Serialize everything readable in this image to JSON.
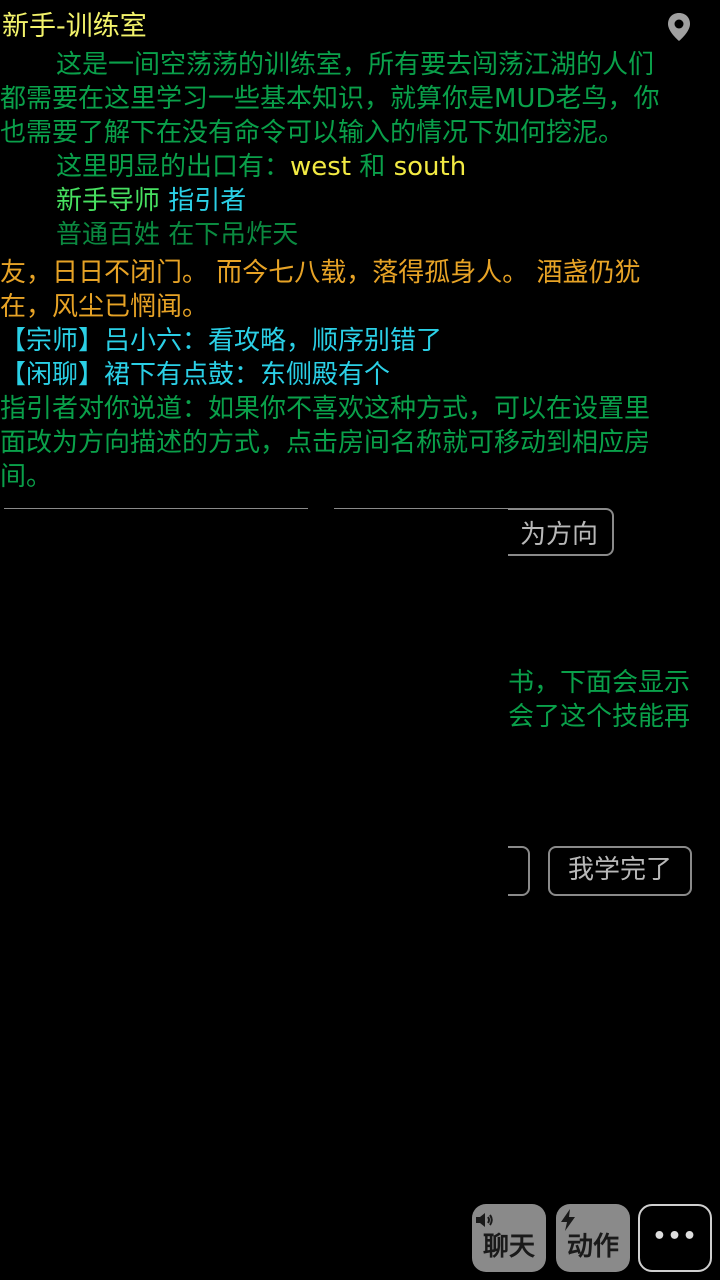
{
  "room": {
    "title": "新手-训练室",
    "location_icon": "map-pin-icon"
  },
  "description": {
    "line1": "这是一间空荡荡的训练室，所有要去闯荡江湖的人们",
    "line2": "都需要在这里学习一些基本知识，就算你是MUD老鸟，你",
    "line3": "也需要了解下在没有命令可以输入的情况下如何挖泥。"
  },
  "exits": {
    "prefix": "这里明显的出口有：",
    "dir1": "west",
    "conj": " 和 ",
    "dir2": "south"
  },
  "npcs": {
    "npc1_title": "新手导师",
    "npc1_name": " 指引者",
    "npc2": "普通百姓 在下吊炸天"
  },
  "poem": {
    "line1": "友，日日不闭门。 而今七八载，落得孤身人。 酒盏仍犹",
    "line2": "在，风尘已惘闻。"
  },
  "chat": {
    "msg1": "【宗师】吕小六：看攻略，顺序别错了",
    "msg2": "【闲聊】裙下有点鼓：东侧殿有个"
  },
  "guide": {
    "line1": "指引者对你说道：如果你不喜欢这种方式，可以在设置里",
    "line2": "面改为方向描述的方式，点击房间名称就可移动到相应房",
    "line3": "间。"
  },
  "overlay": {
    "button_fragment": "为方向",
    "text_fragment1": "书，下面会显示",
    "text_fragment2": "会了这个技能再",
    "done_button": "我学完了"
  },
  "bottom_bar": {
    "chat_label": "聊天",
    "chat_icon": "speaker-icon",
    "action_label": "动作",
    "action_icon": "lightning-icon",
    "more_label": "•••",
    "more_icon": "more-dots-icon"
  },
  "colors": {
    "title": "#f3f36b",
    "narration": "#0aa04a",
    "exit_dir": "#f2ea43",
    "npc_title": "#47e060",
    "npc_name": "#2bd0e6",
    "poem": "#e7a326",
    "chat": "#2bd0e6",
    "button_border": "#8a8a8a"
  }
}
